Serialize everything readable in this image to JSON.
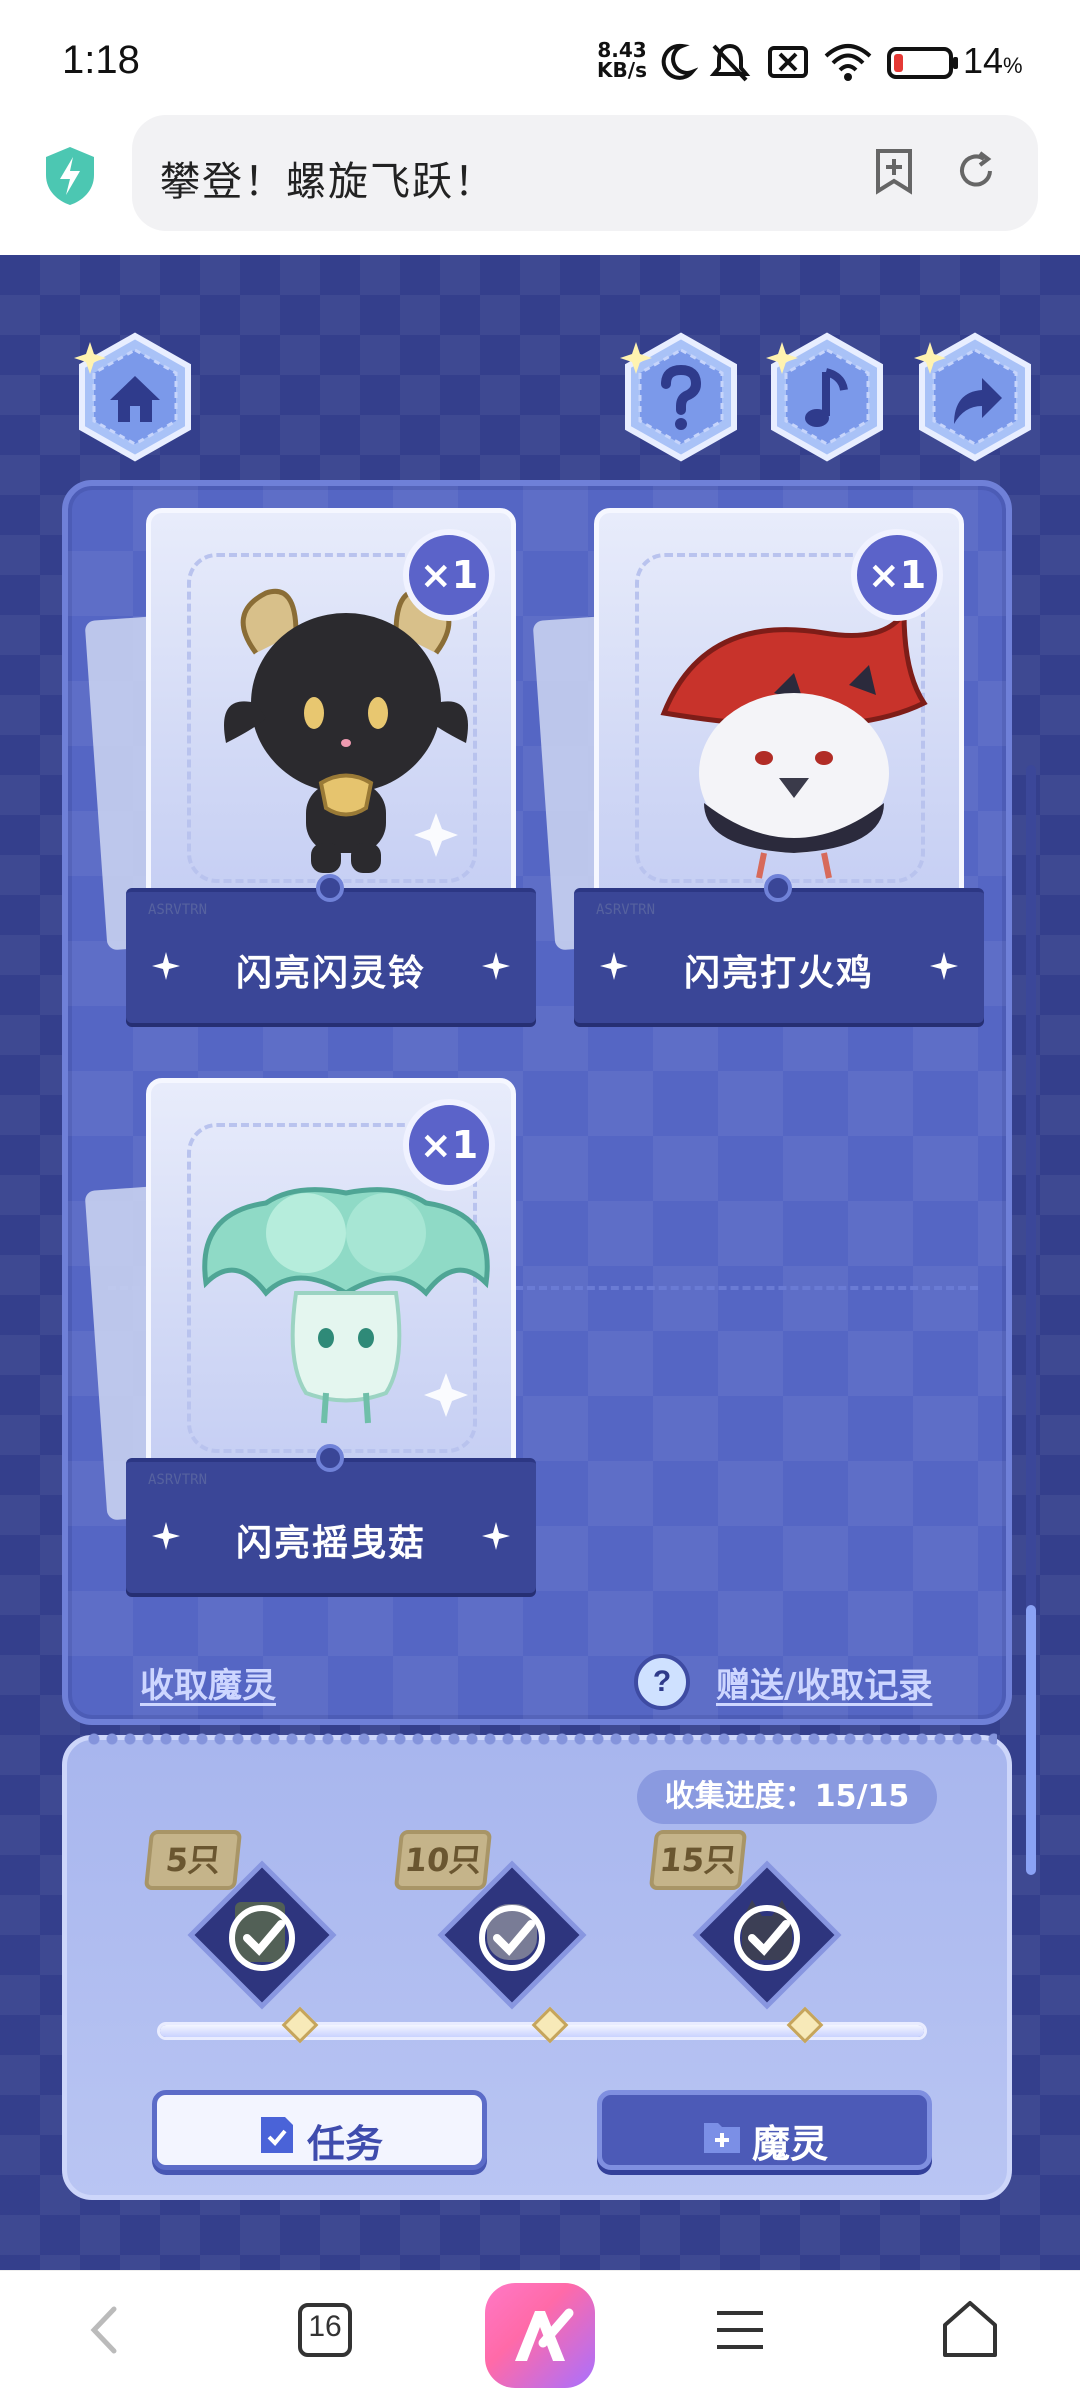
{
  "status_bar": {
    "time": "1:18",
    "net_speed_value": "8.43",
    "net_speed_unit": "KB/s",
    "battery_percent": "14",
    "battery_unit": "%"
  },
  "browser": {
    "address_title": "攀登！螺旋飞跃！",
    "tab_count": "16"
  },
  "game": {
    "top_buttons": [
      "home-icon",
      "help-icon",
      "music-icon",
      "share-icon"
    ],
    "cards": [
      {
        "name": "闪亮闪灵铃",
        "count": "×1"
      },
      {
        "name": "闪亮打火鸡",
        "count": "×1"
      },
      {
        "name": "闪亮摇曳菇",
        "count": "×1"
      }
    ],
    "card_brand": "ASRVTRN",
    "collect_link": "收取魔灵",
    "help_mark": "?",
    "record_link": "赠送/收取记录",
    "progress_label": "收集进度：",
    "progress_value": "15/15",
    "progress_fraction": 1.0,
    "milestones": [
      {
        "tag": "5只",
        "done": true
      },
      {
        "tag": "10只",
        "done": true
      },
      {
        "tag": "15只",
        "done": true
      }
    ],
    "task_button": "任务",
    "spirit_button": "魔灵"
  },
  "colors": {
    "background": "#343f8c",
    "panel": "#5566c4",
    "accent": "#4c5ab7",
    "progress_panel": "#b0bdf0"
  }
}
